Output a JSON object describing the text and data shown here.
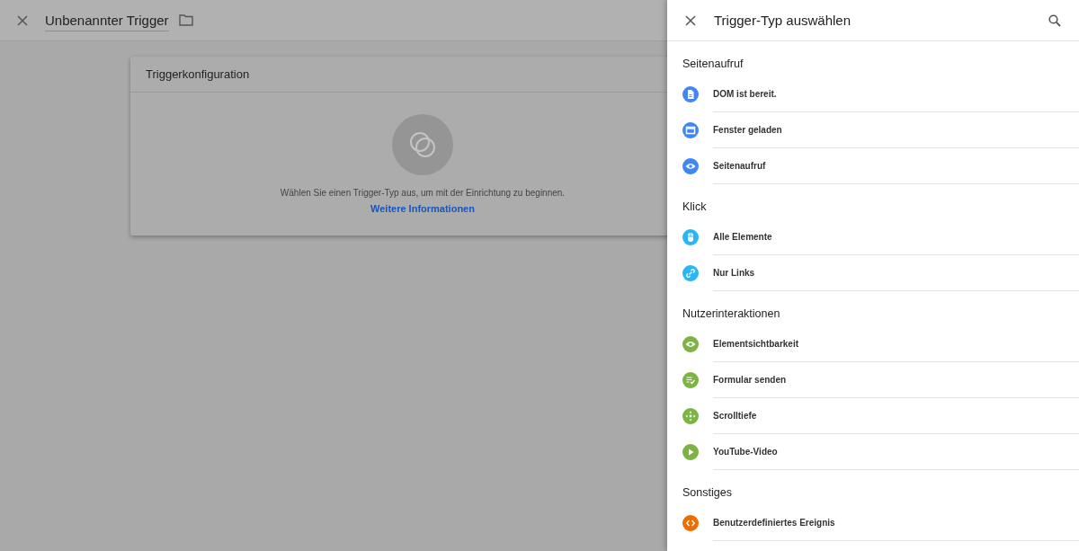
{
  "editor": {
    "title": "Unbenannter Trigger"
  },
  "card": {
    "title": "Triggerkonfiguration",
    "message": "Wählen Sie einen Trigger-Typ aus, um mit der Einrichtung zu beginnen.",
    "link": "Weitere Informationen"
  },
  "panel": {
    "title": "Trigger-Typ auswählen",
    "sections": [
      {
        "title": "Seitenaufruf",
        "items": [
          {
            "label": "DOM ist bereit.",
            "kind": "document",
            "color": "#4285f4"
          },
          {
            "label": "Fenster geladen",
            "kind": "window",
            "color": "#4285f4"
          },
          {
            "label": "Seitenaufruf",
            "kind": "eye",
            "color": "#4285f4"
          }
        ]
      },
      {
        "title": "Klick",
        "items": [
          {
            "label": "Alle Elemente",
            "kind": "mouse",
            "color": "#29b6f6"
          },
          {
            "label": "Nur Links",
            "kind": "link",
            "color": "#29b6f6"
          }
        ]
      },
      {
        "title": "Nutzerinteraktionen",
        "items": [
          {
            "label": "Elementsichtbarkeit",
            "kind": "eye",
            "color": "#7cb342"
          },
          {
            "label": "Formular senden",
            "kind": "form",
            "color": "#7cb342"
          },
          {
            "label": "Scrolltiefe",
            "kind": "move",
            "color": "#7cb342"
          },
          {
            "label": "YouTube-Video",
            "kind": "play",
            "color": "#7cb342"
          }
        ]
      },
      {
        "title": "Sonstiges",
        "items": [
          {
            "label": "Benutzerdefiniertes Ereignis",
            "kind": "code",
            "color": "#ef6c00"
          }
        ]
      }
    ]
  }
}
